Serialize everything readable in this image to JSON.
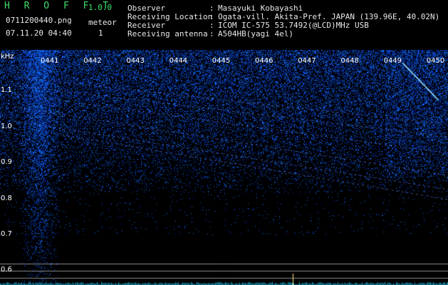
{
  "header": {
    "app_title": "H R O F F T",
    "version": "1.0.0",
    "filename": "0711200440.png",
    "datetime": "07.11.20 04:40",
    "meteor_label": "meteor",
    "meteor_count": "1",
    "fields": [
      {
        "label": "Observer",
        "sep": ":",
        "value": "Masayuki Kobayashi"
      },
      {
        "label": "Receiving Location",
        "sep": ":",
        "value": "Ogata-vill. Akita-Pref. JAPAN (139.96E, 40.02N)"
      },
      {
        "label": "Receiver",
        "sep": ":",
        "value": "ICOM IC-575 53.7492(@LCD)MHz USB"
      },
      {
        "label": "Receiving antenna",
        "sep": ":",
        "value": "A504HB(yagi 4el)"
      }
    ]
  },
  "axis": {
    "unit_label": "kHz",
    "freq_ticks": [
      "1.1",
      "1.0",
      "0.9",
      "0.8",
      "0.7",
      "0.6"
    ],
    "time_ticks": [
      "0441",
      "0442",
      "0443",
      "0444",
      "0445",
      "0446",
      "0447",
      "0448",
      "0449",
      "0450"
    ]
  },
  "colors": {
    "background": "#000000",
    "title_green": "#3ee06b",
    "signal_blue": "#2a4cff",
    "bright_signal": "#9fe8ff",
    "baseline_cyan": "#22d0ff",
    "guide_line": "#8a8a8a"
  }
}
